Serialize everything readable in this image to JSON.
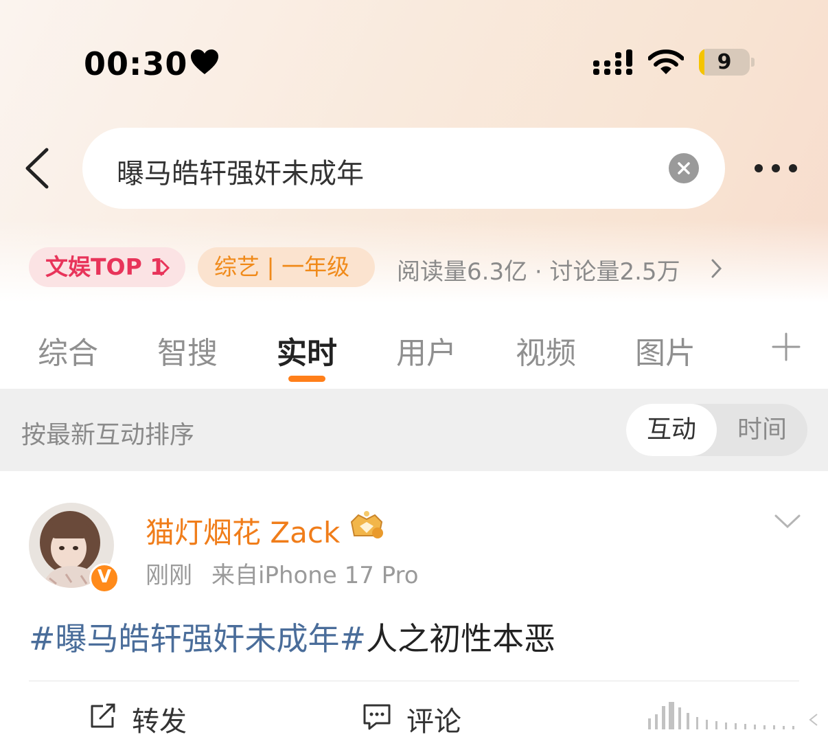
{
  "status_bar": {
    "time": "00:30",
    "battery": "9"
  },
  "search": {
    "query": "曝马皓轩强奸未成年"
  },
  "tags": {
    "rank_label": "文娱TOP 1",
    "category_label": "综艺 | 一年级",
    "stats": "阅读量6.3亿 · 讨论量2.5万"
  },
  "tabs": [
    "综合",
    "智搜",
    "实时",
    "用户",
    "视频",
    "图片"
  ],
  "active_tab": "实时",
  "sort": {
    "label": "按最新互动排序",
    "option_interaction": "互动",
    "option_time": "时间",
    "selected": "互动"
  },
  "post": {
    "username": "猫灯烟花 Zack",
    "time": "刚刚",
    "source": "来自iPhone 17 Pro",
    "hashtag": "#曝马皓轩强奸未成年#",
    "text": "人之初性本恶",
    "actions": {
      "repost": "转发",
      "comment": "评论"
    }
  },
  "colors": {
    "accent_orange": "#ff7f1a",
    "username": "#f07d1a",
    "hashtag": "#4a6d9a",
    "top_tag_text": "#e8345a"
  },
  "icons": [
    "heart-icon",
    "signal-icon",
    "wifi-icon",
    "back-icon",
    "clear-icon",
    "more-icon",
    "plus-icon",
    "crown-badge-icon",
    "verified-v-icon",
    "chevron-down-icon",
    "repost-icon",
    "comment-icon"
  ]
}
